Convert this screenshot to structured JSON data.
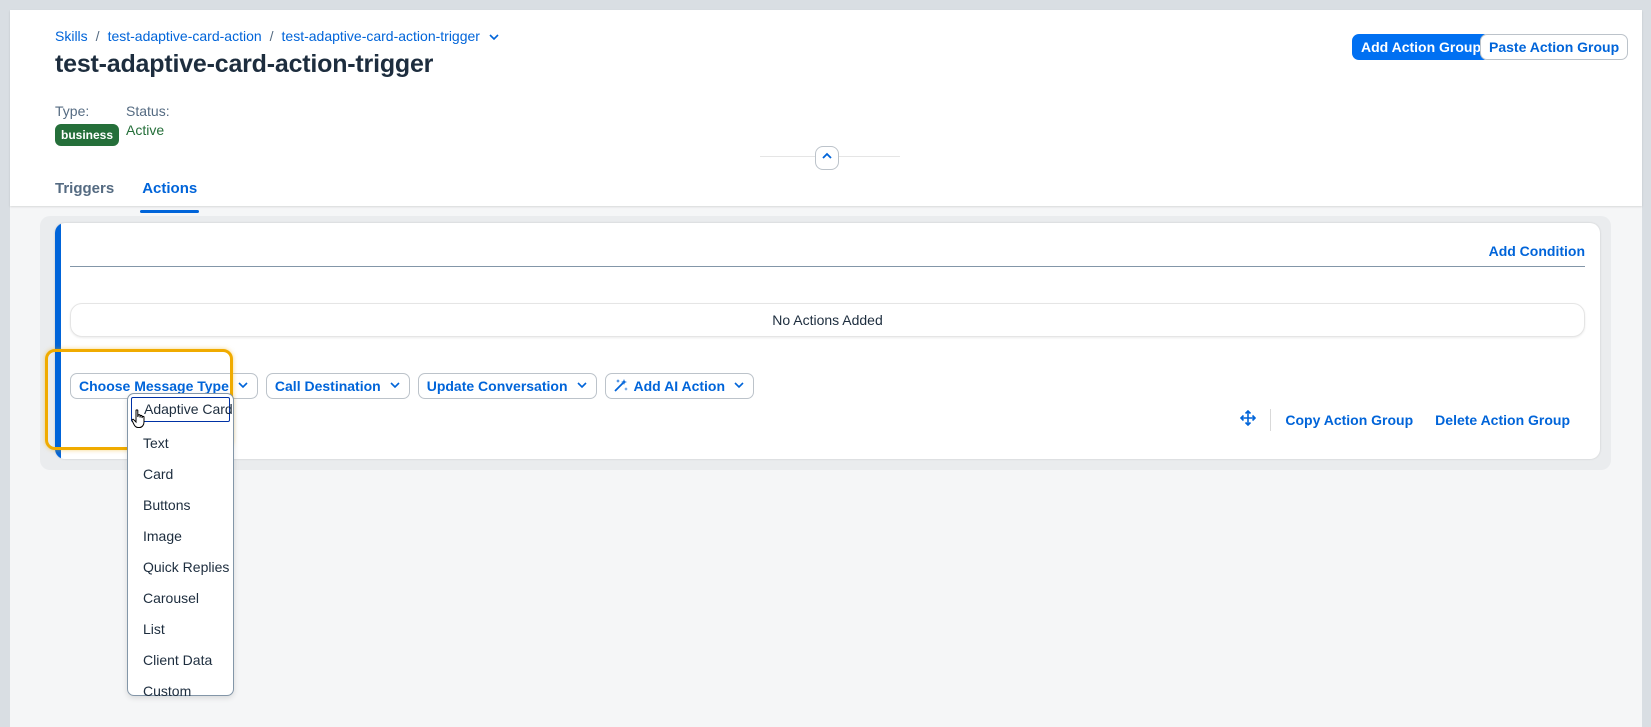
{
  "breadcrumb": {
    "items": [
      "Skills",
      "test-adaptive-card-action",
      "test-adaptive-card-action-trigger"
    ],
    "separator": "/"
  },
  "page": {
    "title": "test-adaptive-card-action-trigger",
    "type_label": "Type:",
    "type_value": "business",
    "status_label": "Status:",
    "status_value": "Active"
  },
  "header_actions": {
    "add_action_group": "Add Action Group",
    "paste_action_group": "Paste Action Group"
  },
  "tabs": [
    {
      "label": "Triggers",
      "active": false
    },
    {
      "label": "Actions",
      "active": true
    }
  ],
  "action_group": {
    "add_condition": "Add Condition",
    "empty_message": "No Actions Added",
    "menu_buttons": {
      "message_type": "Choose Message Type",
      "call_destination": "Call Destination",
      "update_conversation": "Update Conversation",
      "ai_action": "Add AI Action"
    },
    "copy": "Copy Action Group",
    "delete": "Delete Action Group"
  },
  "message_type_menu": {
    "items": [
      "Adaptive Card",
      "Text",
      "Card",
      "Buttons",
      "Image",
      "Quick Replies",
      "Carousel",
      "List",
      "Client Data",
      "Custom"
    ],
    "focused": "Adaptive Card"
  },
  "colors": {
    "accent": "#0064d9",
    "primary_button": "#0070f2",
    "positive": "#256f3a",
    "highlight": "#f0ab00"
  }
}
